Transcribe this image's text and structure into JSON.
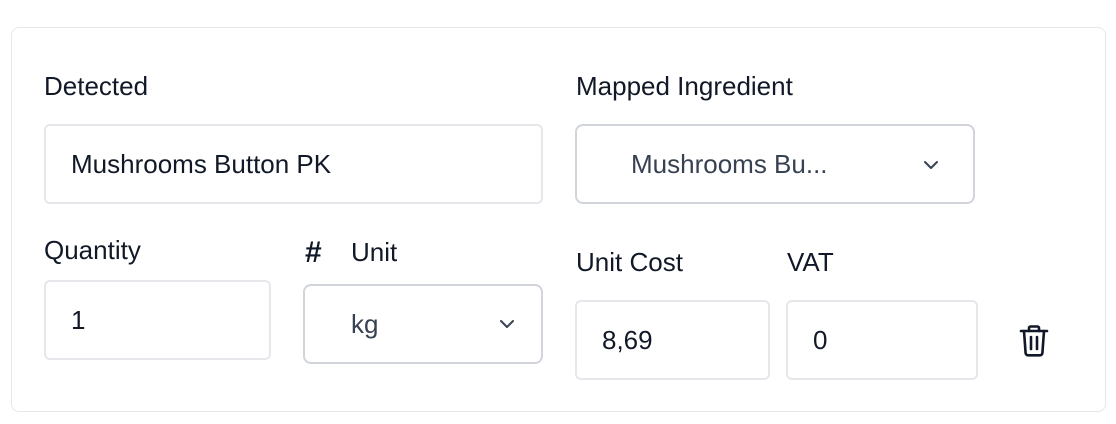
{
  "detected": {
    "label": "Detected",
    "value": "Mushrooms Button PK"
  },
  "mapped_ingredient": {
    "label": "Mapped Ingredient",
    "selected": "Mushrooms Bu..."
  },
  "quantity": {
    "label": "Quantity",
    "value": "1"
  },
  "unit": {
    "icon_text": "#",
    "label": "Unit",
    "selected": "kg"
  },
  "unit_cost": {
    "label": "Unit Cost",
    "value": "8,69"
  },
  "vat": {
    "label": "VAT",
    "value": "0"
  },
  "icons": {
    "unit_icon": "hash-icon",
    "select_chevron": "chevron-down-icon",
    "delete": "trash-icon"
  },
  "colors": {
    "border": "#e5e7eb",
    "select_border": "#d1d5db",
    "text": "#111827",
    "muted_text": "#374151"
  }
}
